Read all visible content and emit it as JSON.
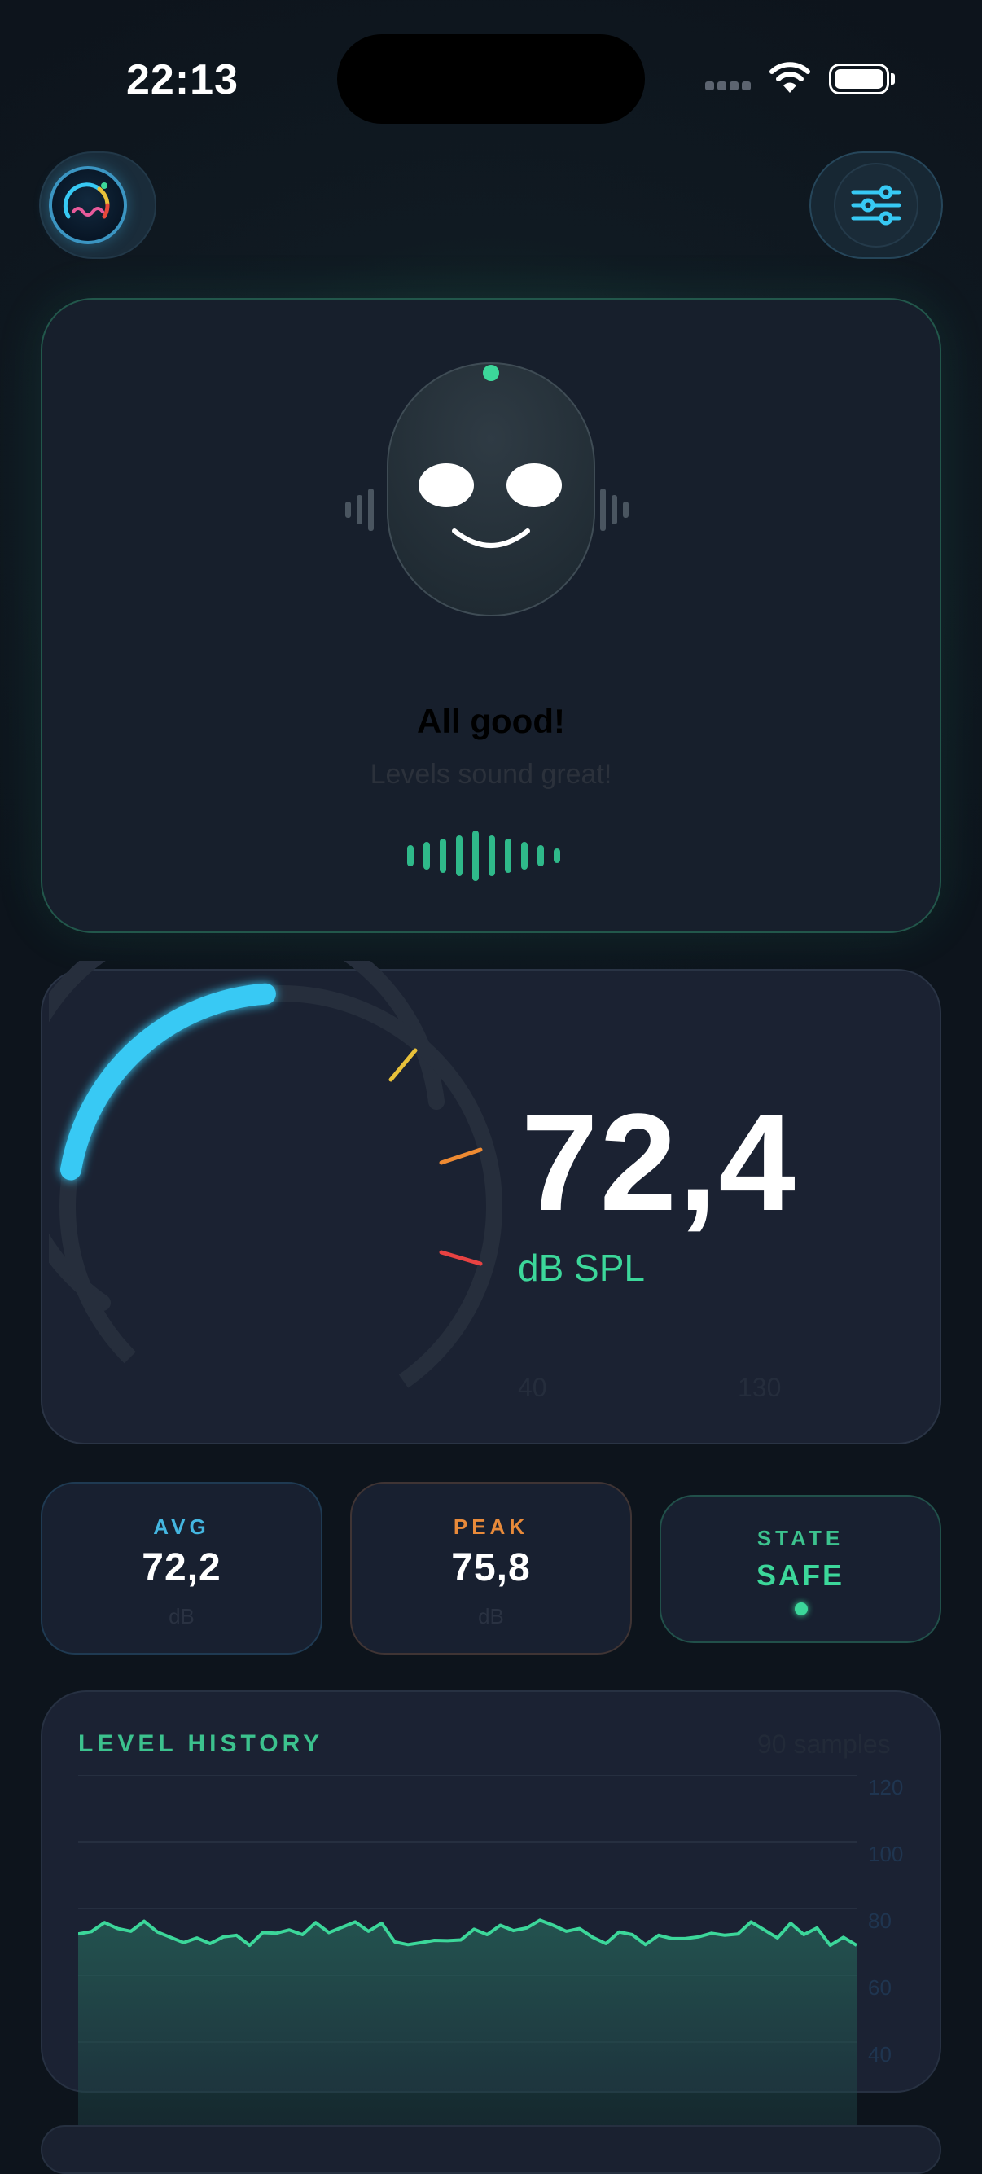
{
  "status_bar": {
    "time": "22:13"
  },
  "mascot": {
    "title": "All good!",
    "subtitle": "Levels sound great!",
    "mood": "happy",
    "accent": "#3cd79a"
  },
  "meter": {
    "value": "72,4",
    "unit": "dB SPL",
    "level_db": 72.4,
    "scale_min_label": "40",
    "scale_max_label": "130",
    "arc_color": "#37c9f4"
  },
  "stats": {
    "avg": {
      "label": "AVG",
      "value": "72,2",
      "unit": "dB",
      "color": "#44b6e0"
    },
    "peak": {
      "label": "PEAK",
      "value": "75,8",
      "unit": "dB",
      "color": "#e88a3a"
    },
    "state": {
      "label": "STATE",
      "value": "SAFE",
      "color": "#3cd79a"
    }
  },
  "history": {
    "title": "LEVEL HISTORY",
    "samples_label": "90 samples",
    "y_axis_labels": [
      "120",
      "100",
      "80",
      "60",
      "40"
    ],
    "line_color": "#3cd79a"
  },
  "chart_data": {
    "type": "area",
    "ylim": [
      40,
      120
    ],
    "y_ticks": [
      120,
      100,
      80,
      60,
      40
    ],
    "series": [
      {
        "values": [
          72.4,
          73.1,
          75.8,
          74.0,
          73.2,
          76.2,
          73.0,
          71.4,
          69.8,
          71.2,
          69.5,
          71.5,
          72.0,
          69.0,
          72.8,
          72.6,
          73.6,
          72.2,
          75.8,
          72.8,
          74.4,
          76.0,
          73.2,
          75.6,
          70.0,
          69.2,
          69.8,
          70.5,
          70.4,
          70.6,
          73.8,
          72.2,
          75.0,
          73.4,
          74.2,
          76.5,
          75.0,
          73.2,
          74.0,
          71.4,
          69.5,
          73.0,
          72.2,
          69.2,
          72.0,
          71.0,
          71.0,
          71.5,
          72.6,
          72.0,
          72.4,
          76.0,
          73.6,
          71.2,
          75.6,
          72.2,
          74.2,
          69.0,
          71.4,
          69.0
        ]
      }
    ]
  }
}
